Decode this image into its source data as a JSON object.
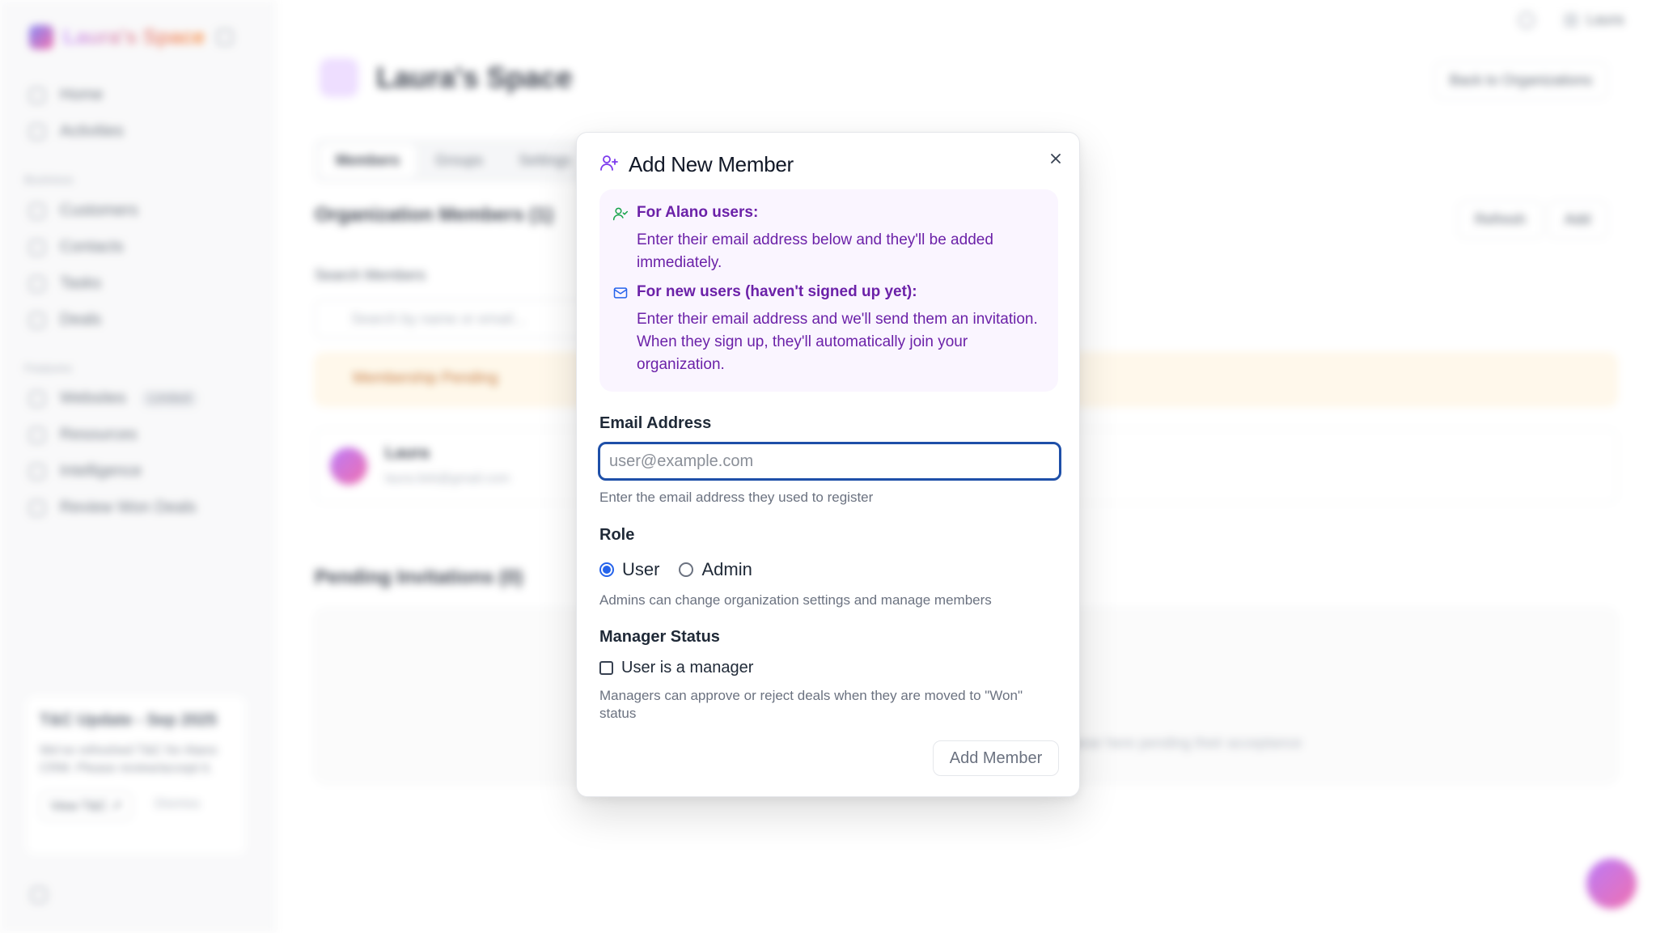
{
  "app": {
    "brand_name": "Laura's Space",
    "nav": {
      "items": [
        {
          "label": "Home"
        },
        {
          "label": "Activities"
        }
      ],
      "section_business": "Business",
      "business_items": [
        {
          "label": "Customers"
        },
        {
          "label": "Contacts"
        },
        {
          "label": "Tasks"
        },
        {
          "label": "Deals"
        }
      ],
      "section_features": "Features",
      "feature_items": [
        {
          "label": "Websites",
          "badge": "Limited"
        },
        {
          "label": "Resources"
        },
        {
          "label": "Intelligence"
        },
        {
          "label": "Review Won Deals"
        }
      ]
    },
    "notice": {
      "title": "T&C Update - Sep 2025",
      "text": "We've refreshed T&C for Alano CRM. Please review/accept it.",
      "view_label": "View T&C ↗",
      "dismiss_label": "Dismiss"
    },
    "topbar": {
      "user_label": "Laura"
    },
    "org": {
      "title": "Laura's Space",
      "back_label": "Back to Organizations",
      "tabs": [
        {
          "label": "Members"
        },
        {
          "label": "Groups"
        },
        {
          "label": "Settings"
        }
      ],
      "members_title": "Organization Members (1)",
      "refresh_label": "Refresh",
      "add_label": "Add",
      "search_label": "Search Members",
      "search_placeholder": "Search by name or email...",
      "pending_label": "Membership Pending",
      "member": {
        "name": "Laura",
        "email": "laura.lieb@gmail.com"
      },
      "invites_title": "Pending Invitations (0)",
      "invites_empty": "...will appear here pending their acceptance"
    }
  },
  "modal": {
    "title": "Add New Member",
    "icons": {
      "title": "user-plus-icon",
      "close": "close-icon",
      "alano": "user-check-icon",
      "new_users": "mail-icon"
    },
    "info": {
      "alano_heading": "For Alano users:",
      "alano_text": "Enter their email address below and they'll be added immediately.",
      "new_heading": "For new users (haven't signed up yet):",
      "new_text": "Enter their email address and we'll send them an invitation. When they sign up, they'll automatically join your organization."
    },
    "email": {
      "label": "Email Address",
      "value": "",
      "placeholder": "user@example.com",
      "hint": "Enter the email address they used to register"
    },
    "role": {
      "label": "Role",
      "options": [
        {
          "label": "User",
          "selected": true
        },
        {
          "label": "Admin",
          "selected": false
        }
      ],
      "hint": "Admins can change organization settings and manage members"
    },
    "manager": {
      "label": "Manager Status",
      "checkbox_label": "User is a manager",
      "checked": false,
      "hint": "Managers can approve or reject deals when they are moved to \"Won\" status"
    },
    "submit_label": "Add Member"
  },
  "colors": {
    "accent": "#2563eb",
    "info_bg": "#faf5ff",
    "info_text": "#6b21a8",
    "focus_ring": "#1e4fa8",
    "alano_icon": "#16a34a",
    "mail_icon": "#2563eb"
  }
}
